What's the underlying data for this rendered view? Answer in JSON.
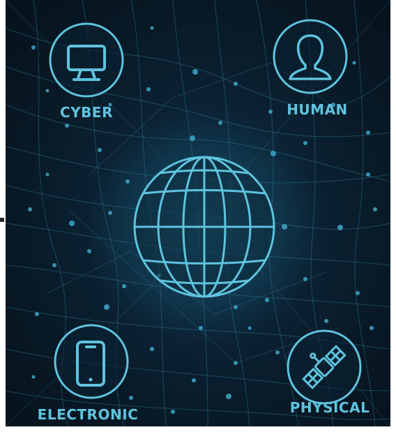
{
  "nodes": [
    {
      "id": "cyber",
      "label": "CYBER",
      "icon": "monitor-icon"
    },
    {
      "id": "human",
      "label": "HUMAN",
      "icon": "person-icon"
    },
    {
      "id": "electronic",
      "label": "ELECTRONIC",
      "icon": "smartphone-icon"
    },
    {
      "id": "physical",
      "label": "PHYSICAL",
      "icon": "satellite-icon"
    }
  ],
  "center_icon": "globe-icon",
  "colors": {
    "background": "#081824",
    "accent": "#5fc3de",
    "network": "#2e7fa0"
  }
}
